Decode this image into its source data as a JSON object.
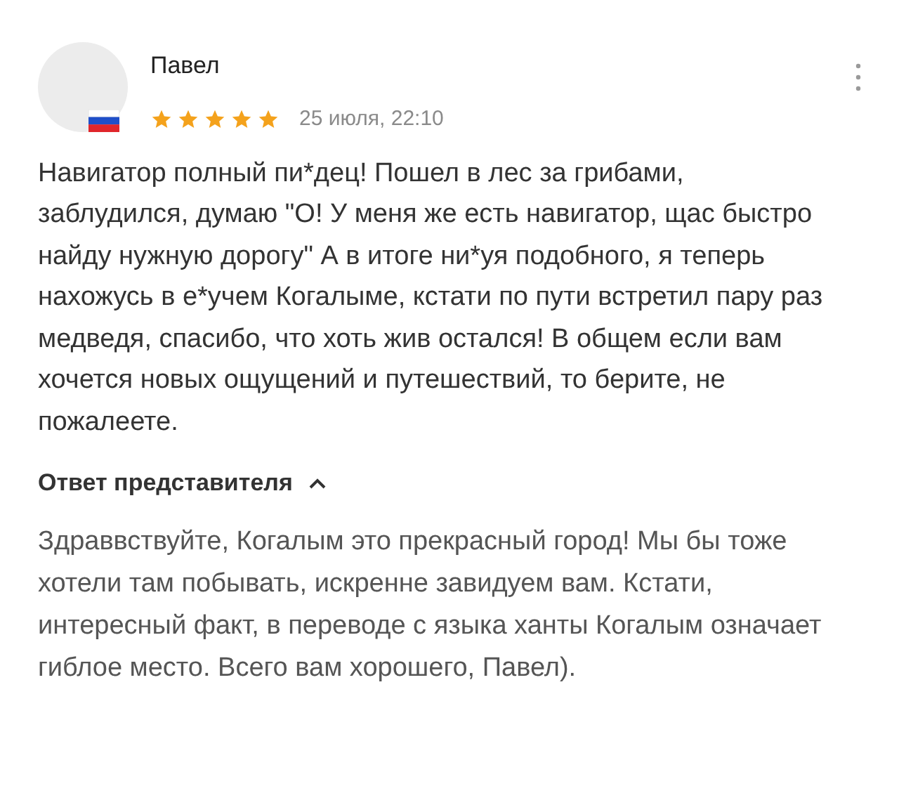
{
  "review": {
    "author": "Павел",
    "stars": 5,
    "date": "25 июля, 22:10",
    "text": "Навигатор полный пи*дец! Пошел в лес за грибами, заблудился, думаю \"О! У меня же есть навигатор, щас быстро найду нужную дорогу\" А в итоге ни*уя подобного, я теперь нахожусь в е*учем Когалыме, кстати по пути встретил пару раз медведя, спасибо, что хоть жив остался! В общем если вам хочется новых ощущений и путешествий, то берите, не пожалеете."
  },
  "reply": {
    "title": "Ответ представителя",
    "expanded": true,
    "text": "Здраввствуйте, Когалым это прекрасный город! Мы бы тоже хотели там побывать, искренне завидуем вам. Кстати, интересный факт, в переводе с языка ханты Когалым означает гиблое место. Всего вам хорошего, Павел)."
  }
}
